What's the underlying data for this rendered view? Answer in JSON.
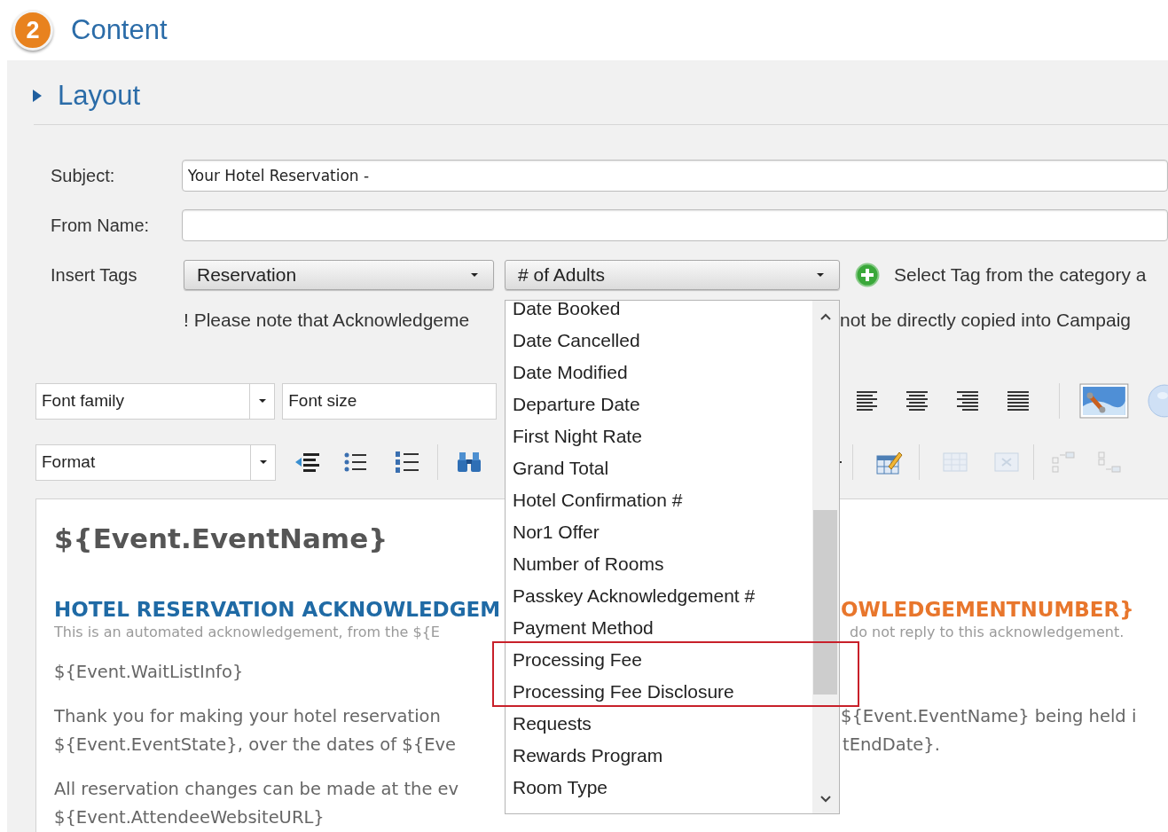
{
  "section": {
    "number": "2",
    "title": "Content"
  },
  "subsection": {
    "title": "Layout"
  },
  "form": {
    "subject": {
      "label": "Subject:",
      "value": "Your Hotel Reservation -"
    },
    "from_name": {
      "label": "From Name:"
    },
    "insert_tags": {
      "label": "Insert Tags",
      "category": "Reservation",
      "tag": "# of Adults",
      "hint": "Select Tag from the category a"
    },
    "note_left": "! Please note that Acknowledgeme",
    "note_right": "not be directly copied into Campaig"
  },
  "toolbar": {
    "font_family": "Font family",
    "font_size": "Font size",
    "format": "Format"
  },
  "editor": {
    "blocks": [
      {
        "kind": "title",
        "lines": [
          {
            "left": "${Event.EventName}"
          }
        ]
      },
      {
        "kind": "heading",
        "lines": [
          {
            "left": "HOTEL RESERVATION ACKNOWLEDGEM",
            "right": "OWLEDGEMENTNUMBER}"
          }
        ]
      },
      {
        "kind": "subtitle",
        "lines": [
          {
            "left": "This is an automated acknowledgement, from the ${E",
            "right": "do not reply to this acknowledgement."
          }
        ]
      },
      {
        "kind": "text",
        "lines": [
          {
            "left": "${Event.WaitListInfo}"
          }
        ]
      },
      {
        "kind": "text",
        "lines": [
          {
            "left": "Thank you for making your hotel reservation",
            "right": "${Event.EventName} being held i"
          },
          {
            "left": "${Event.EventState}, over the dates of ${Eve",
            "right": "tEndDate}."
          }
        ]
      },
      {
        "kind": "text",
        "lines": [
          {
            "left": "All reservation changes can be made at the ev"
          },
          {
            "left": "${Event.AttendeeWebsiteURL}"
          }
        ]
      }
    ]
  },
  "tag_list": {
    "items": [
      {
        "label": "Date Booked",
        "highlighted": false
      },
      {
        "label": "Date Cancelled",
        "highlighted": false
      },
      {
        "label": "Date Modified",
        "highlighted": false
      },
      {
        "label": "Departure Date",
        "highlighted": false
      },
      {
        "label": "First Night Rate",
        "highlighted": false
      },
      {
        "label": "Grand Total",
        "highlighted": false
      },
      {
        "label": "Hotel Confirmation #",
        "highlighted": false
      },
      {
        "label": "Nor1 Offer",
        "highlighted": false
      },
      {
        "label": "Number of Rooms",
        "highlighted": false
      },
      {
        "label": "Passkey Acknowledgement #",
        "highlighted": false
      },
      {
        "label": "Payment Method",
        "highlighted": false
      },
      {
        "label": "Processing Fee",
        "highlighted": true
      },
      {
        "label": "Processing Fee Disclosure",
        "highlighted": true
      },
      {
        "label": "Requests",
        "highlighted": false
      },
      {
        "label": "Rewards Program",
        "highlighted": false
      },
      {
        "label": "Room Type",
        "highlighted": false
      }
    ]
  }
}
